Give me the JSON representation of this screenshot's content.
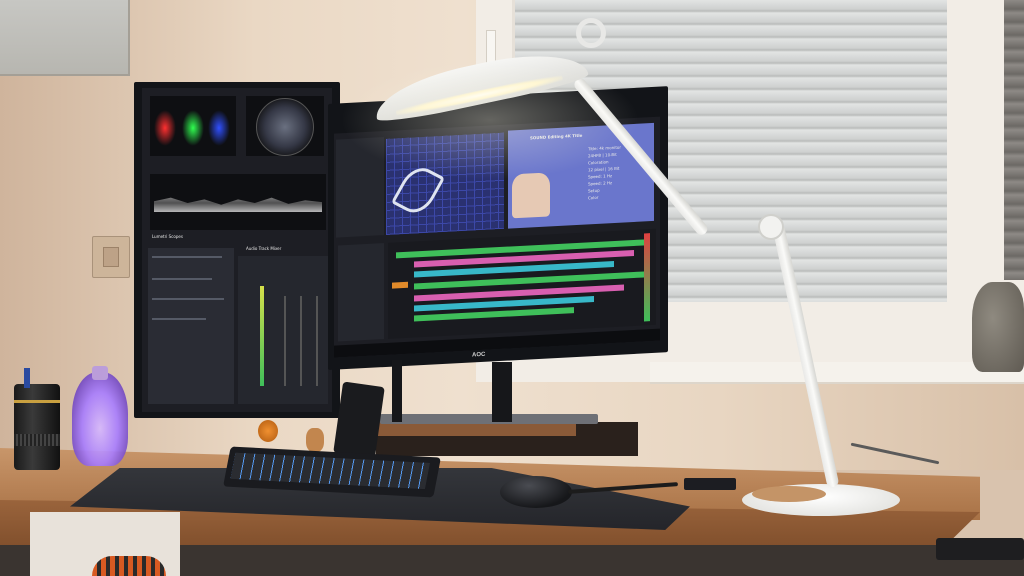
{
  "scene": {
    "description_alt": "",
    "colors": {
      "wall_light": "#efe0cf",
      "wall_shadow": "#c9ad93",
      "window_frame": "#f2ede6",
      "blinds": "#d8dad9",
      "desk_top": "#b8855a",
      "desk_edge": "#8c5b36",
      "desk_mat": "#2a2b2f",
      "monitor_bezel": "#121418",
      "premiere_bg": "#1d1e24",
      "timeline_green": "#3fbf5a",
      "timeline_pink": "#d85fb0",
      "timeline_cyan": "#38b8c8",
      "timeline_orange": "#e08a2a",
      "lamp_white": "#f3f3f1",
      "lamp_cork": "#c49467",
      "keyboard_rgb": "#5aa2ff",
      "bottle_purple": "#a77cff"
    }
  },
  "landscape_monitor": {
    "brand": "AOC",
    "preview_title": "SOUND  Editing 4K Title",
    "preview_text": [
      "Title: 4k monitor",
      "24HFB | 10-Bit",
      "Coloration",
      "12 pixel | 16 Bit",
      "Speed: 1 Hz",
      "Speed: 2 Hz",
      "Setup",
      "Color"
    ]
  },
  "portrait_monitor": {
    "panel_labels": [
      "Lumetri Scopes",
      "Audio Track Mixer"
    ]
  },
  "desk_props": {
    "keyboard": "mechanical-keyboard",
    "mouse": "gaming-mouse",
    "lamp": "architect-desk-lamp",
    "bottle": "crystal-skull-bottle",
    "lens_mug": "camera-lens-mug"
  }
}
